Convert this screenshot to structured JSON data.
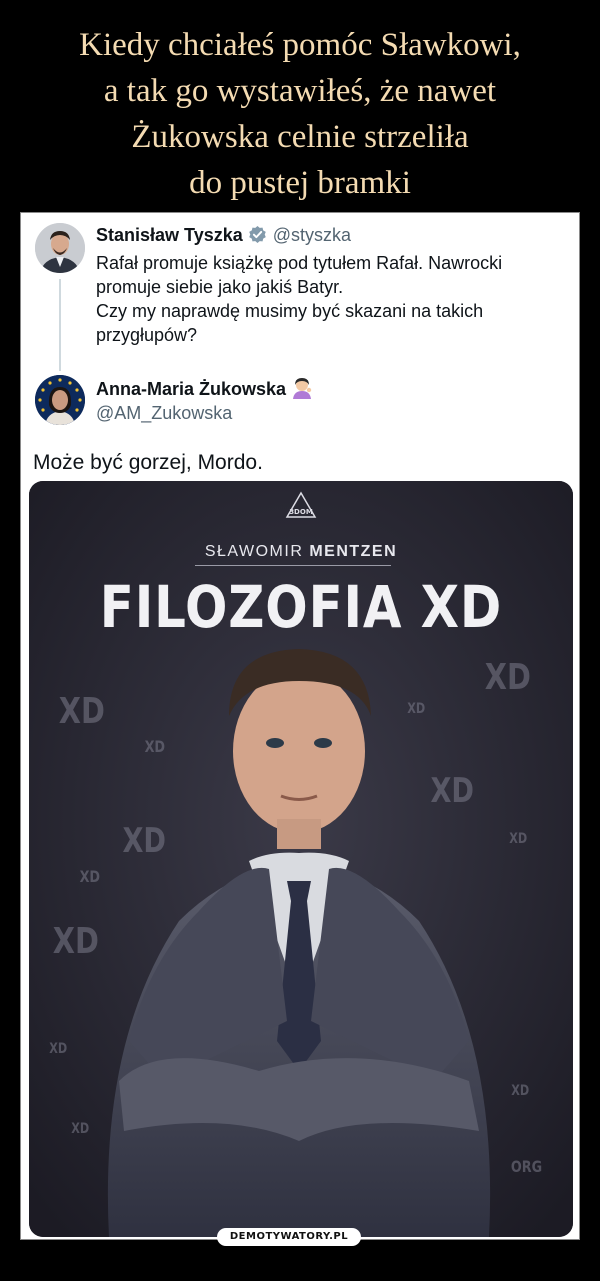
{
  "meme": {
    "title": "Kiedy chciałeś pomóc Sławkowi,\na tak go wystawiłeś, że nawet\nŻukowska celnie strzeliła\ndo pustej bramki",
    "watermark": "DEMOTYWATORY.PL"
  },
  "tweet1": {
    "author_name": "Stanisław Tyszka",
    "handle": "@styszka",
    "lines": [
      "Rafał promuje książkę pod tytułem Rafał. Nawrocki",
      "promuje siebie jako jakiś Batyr.",
      "Czy my naprawdę musimy być skazani na takich",
      "przygłupów?"
    ],
    "verified_icon": "verified-badge-icon",
    "verified_color": "#829aab"
  },
  "tweet2": {
    "author_name": "Anna-Maria Żukowska",
    "handle": "@AM_Zukowska",
    "emoji_icon": "person-tipping-hand-emoji",
    "reply": "Może być gorzej, Mordo."
  },
  "book": {
    "publisher_logo": "3DOM",
    "author_first": "SŁAWOMIR",
    "author_last": "MENTZEN",
    "title": "FILOZOFIA XD",
    "background_pattern": "XD",
    "corner_watermark": "ORG"
  },
  "colors": {
    "title_text": "#f4dbb2",
    "cover_background": "#2b2a35"
  }
}
